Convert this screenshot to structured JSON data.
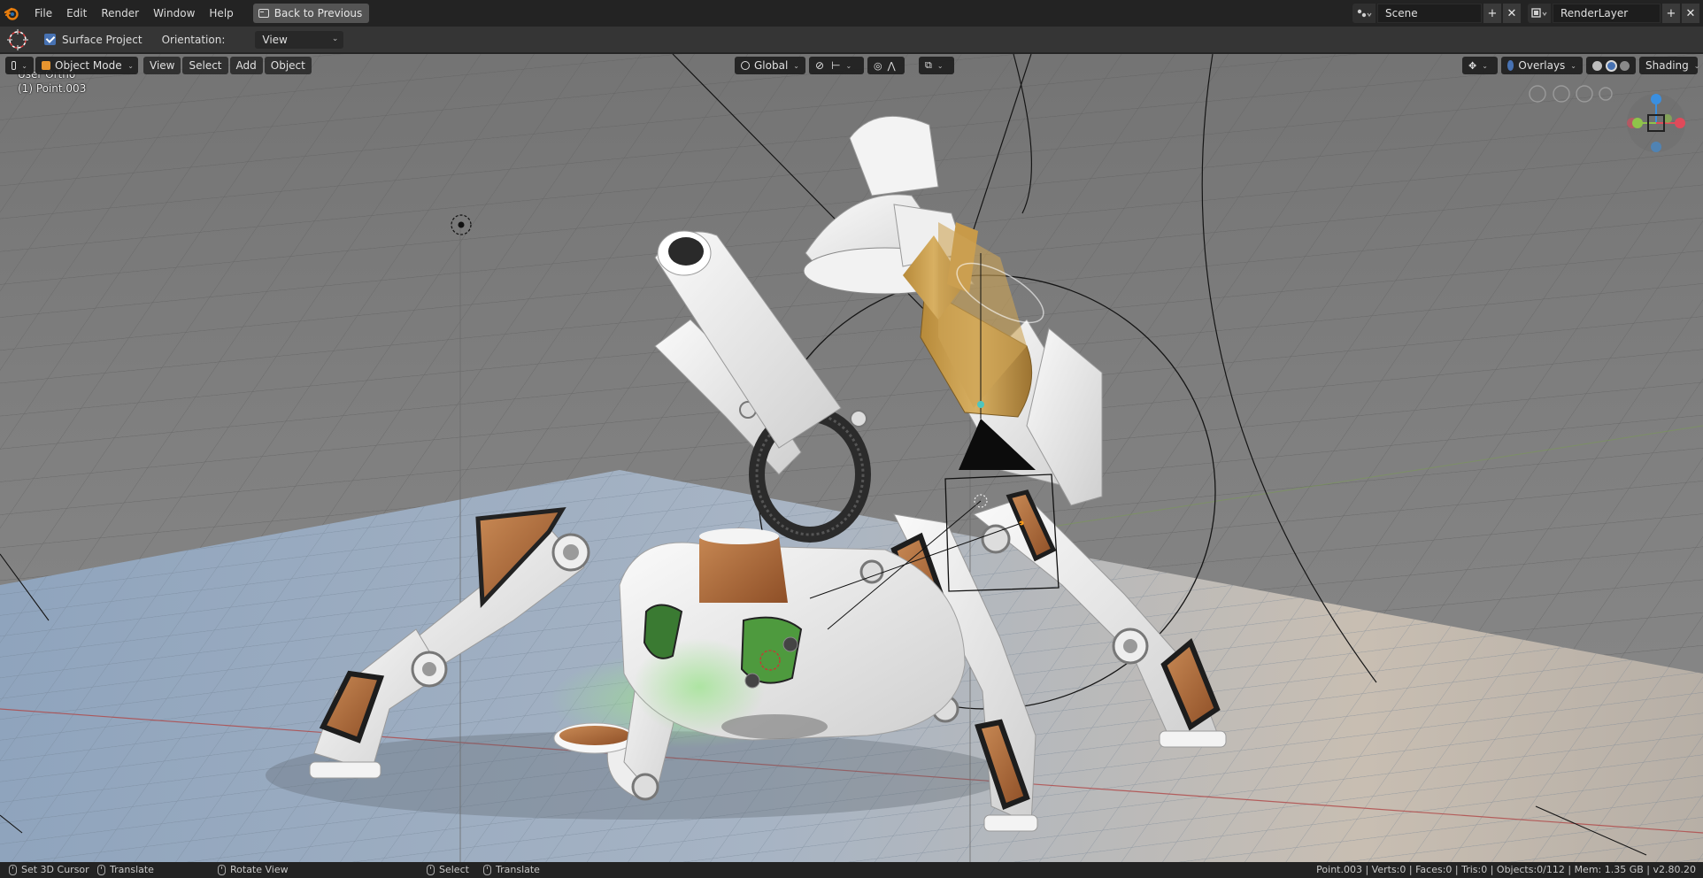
{
  "topbar": {
    "menus": [
      "File",
      "Edit",
      "Render",
      "Window",
      "Help"
    ],
    "back_button": "Back to Previous",
    "scene_name": "Scene",
    "render_layer": "RenderLayer",
    "add_symbol": "+",
    "close_symbol": "✕"
  },
  "toolheader": {
    "surface_project_label": "Surface Project",
    "surface_project_checked": true,
    "orientation_label": "Orientation:",
    "orientation_value": "View"
  },
  "viewport_header": {
    "mode": "Object Mode",
    "menus": [
      "View",
      "Select",
      "Add",
      "Object"
    ],
    "transform_orientation": "Global",
    "overlays_label": "Overlays",
    "shading_label": "Shading"
  },
  "viewport": {
    "view_name": "User Ortho",
    "active_object": "(1) Point.003"
  },
  "statusbar": {
    "left_items": [
      "Set 3D Cursor",
      "Translate",
      "Rotate View"
    ],
    "mid_items": [
      "Select",
      "Translate"
    ],
    "stats": "Point.003 | Verts:0 | Faces:0 | Tris:0 | Objects:0/112 | Mem: 1.35 GB | v2.80.20"
  },
  "colors": {
    "accent": "#4772b3",
    "header_bg": "#232323",
    "toolheader_bg": "#353535",
    "grid_floor": "#7a7a7a",
    "copper": "#b06a3a",
    "robot_white": "#ececec"
  },
  "icons": [
    "blender-logo-icon",
    "back-window-icon",
    "scene-icon",
    "render-layer-icon",
    "cursor-tool-icon",
    "editor-type-icon",
    "object-mode-icon",
    "global-icon",
    "snap-icon",
    "proportional-icon",
    "visibility-icon",
    "overlays-icon",
    "shading-solid-icon",
    "shading-material-icon",
    "shading-render-icon",
    "navigation-gizmo-icon",
    "mouse-left-icon",
    "mouse-middle-icon",
    "mouse-right-icon"
  ]
}
